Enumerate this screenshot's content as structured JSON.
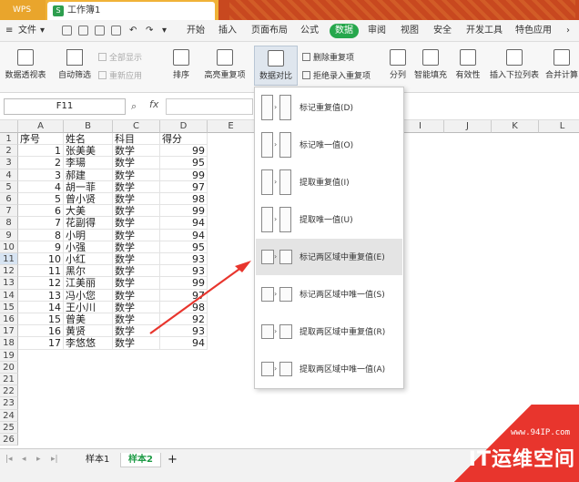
{
  "titlebar": {
    "app": "WPS",
    "doc_tab": "工作簿1",
    "doc_icon": "S"
  },
  "menubar": {
    "file": "文件",
    "tabs": [
      "开始",
      "插入",
      "页面布局",
      "公式",
      "数据",
      "审阅",
      "视图",
      "安全",
      "开发工具",
      "特色应用"
    ],
    "active_tab": "数据"
  },
  "ribbon": {
    "pivot": "数据透视表",
    "autofilter": "自动筛选",
    "show_all": "全部显示",
    "reapply": "重新应用",
    "sort": "排序",
    "highlight_dup": "高亮重复项",
    "data_compare": "数据对比",
    "remove_dup": "删除重复项",
    "reject_dup": "拒绝录入重复项",
    "split": "分列",
    "smart_fill": "智能填充",
    "validity": "有效性",
    "insert_dropdown": "插入下拉列表",
    "merge_calc": "合并计算"
  },
  "formula_bar": {
    "cell_ref": "F11",
    "fx": "fx"
  },
  "columns": [
    "A",
    "B",
    "C",
    "D",
    "E",
    "F",
    "G",
    "H",
    "I",
    "J",
    "K",
    "L"
  ],
  "rows": [
    [
      "序号",
      "姓名",
      "科目",
      "得分"
    ],
    [
      "1",
      "张美美",
      "数学",
      "99"
    ],
    [
      "2",
      "李瑒",
      "数学",
      "95"
    ],
    [
      "3",
      "郝建",
      "数学",
      "99"
    ],
    [
      "4",
      "胡一菲",
      "数学",
      "97"
    ],
    [
      "5",
      "曾小贤",
      "数学",
      "98"
    ],
    [
      "6",
      "大美",
      "数学",
      "99"
    ],
    [
      "7",
      "花副得",
      "数学",
      "94"
    ],
    [
      "8",
      "小明",
      "数学",
      "94"
    ],
    [
      "9",
      "小强",
      "数学",
      "95"
    ],
    [
      "10",
      "小红",
      "数学",
      "93"
    ],
    [
      "11",
      "黑尔",
      "数学",
      "93"
    ],
    [
      "12",
      "江美丽",
      "数学",
      "99"
    ],
    [
      "13",
      "冯小您",
      "数学",
      "97"
    ],
    [
      "14",
      "王小川",
      "数学",
      "98"
    ],
    [
      "15",
      "曾美",
      "数学",
      "92"
    ],
    [
      "16",
      "黄贤",
      "数学",
      "93"
    ],
    [
      "17",
      "李悠悠",
      "数学",
      "94"
    ]
  ],
  "row_numbers": [
    "1",
    "2",
    "3",
    "4",
    "5",
    "6",
    "7",
    "8",
    "9",
    "10",
    "11",
    "12",
    "13",
    "14",
    "15",
    "16",
    "17",
    "18",
    "19",
    "20",
    "21",
    "22",
    "23",
    "24",
    "25",
    "26"
  ],
  "dropdown": [
    "标记重复值(D)",
    "标记唯一值(O)",
    "提取重复值(I)",
    "提取唯一值(U)",
    "标记两区域中重复值(E)",
    "标记两区域中唯一值(S)",
    "提取两区域中重复值(R)",
    "提取两区域中唯一值(A)"
  ],
  "sheet_tabs": [
    "样本1",
    "样本2"
  ],
  "active_sheet": "样本2",
  "add_sheet": "+",
  "watermark": {
    "url": "www.94IP.com",
    "logo": "IT运维空间"
  },
  "colors": {
    "accent": "#26a74c",
    "arrow": "#e8352d",
    "titlebar": "#f0b238"
  }
}
